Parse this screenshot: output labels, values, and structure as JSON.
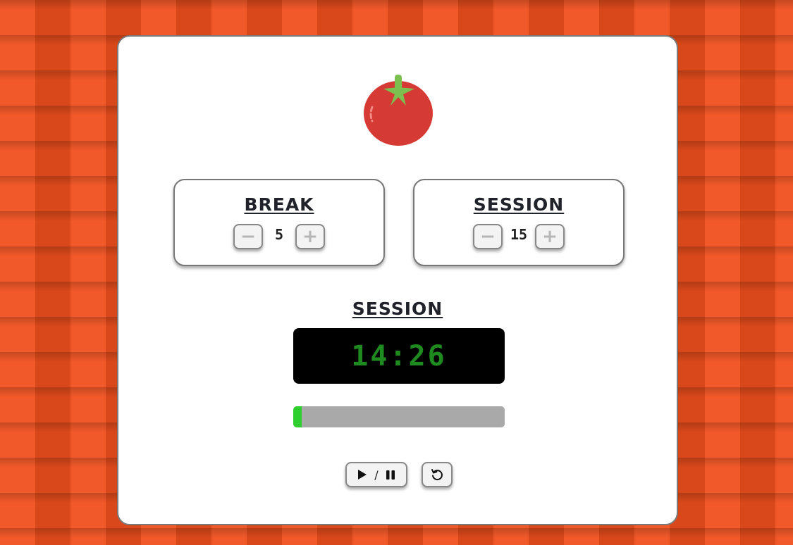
{
  "icons": {
    "logo": "tomato-icon",
    "play": "play-icon",
    "pause": "pause-icon",
    "reset": "reset-icon"
  },
  "colors": {
    "background": "#e8531f",
    "tomato": "#d63a34",
    "leaf": "#7cc04f",
    "timer_text": "#1f8a1f",
    "progress_fill": "#2fcf2f",
    "progress_track": "#a9a9a9"
  },
  "break": {
    "title": "BREAK",
    "decrement": "−",
    "value": "5",
    "increment": "+"
  },
  "session": {
    "title": "SESSION",
    "decrement": "−",
    "value": "15",
    "increment": "+"
  },
  "timer": {
    "label": "SESSION",
    "time": "14:26",
    "progress_percent": 4
  },
  "controls": {
    "separator": "/"
  }
}
